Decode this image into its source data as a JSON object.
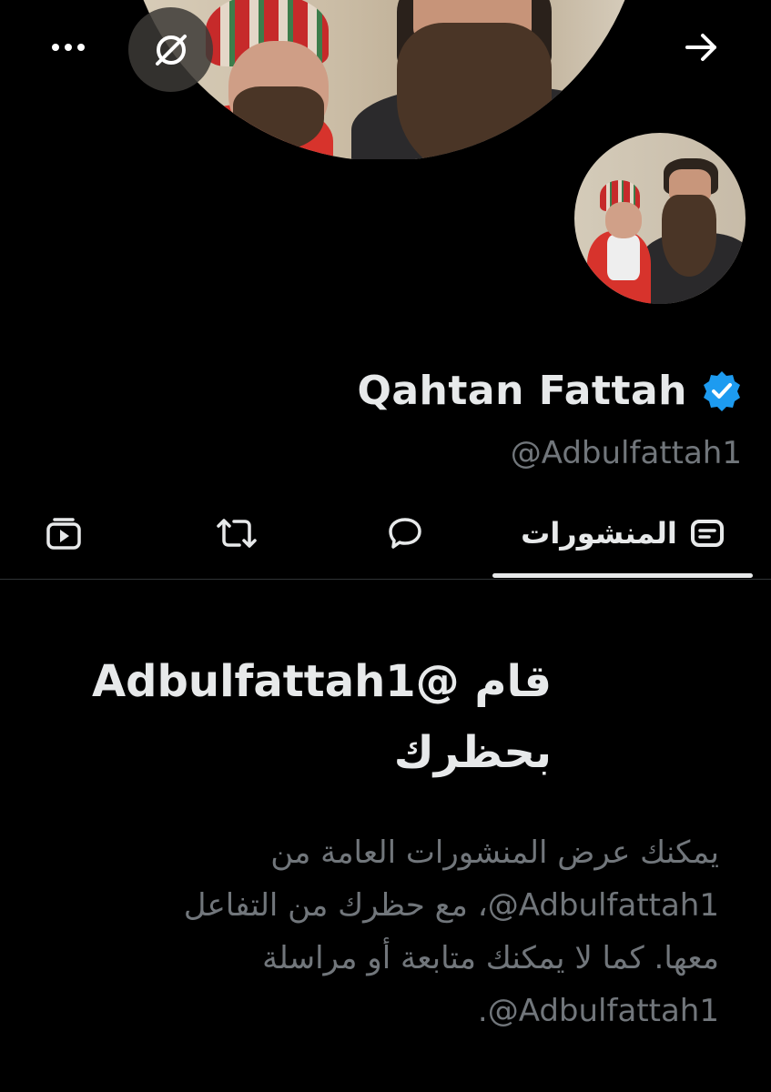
{
  "profile": {
    "display_name": "Qahtan Fattah",
    "handle": "@Adbulfattah1",
    "verified": true,
    "verified_color": "#1d9bf0"
  },
  "header": {
    "more_icon": "more-horizontal-icon",
    "grok_icon": "grok-icon",
    "back_icon": "arrow-right-icon"
  },
  "tabs": [
    {
      "label": "المنشورات",
      "icon": "posts-icon",
      "active": true
    },
    {
      "label": "",
      "icon": "reply-bubble-icon",
      "active": false
    },
    {
      "label": "",
      "icon": "repost-icon",
      "active": false
    },
    {
      "label": "",
      "icon": "media-video-icon",
      "active": false
    }
  ],
  "blocked": {
    "title": "قام @Adbulfattah1 بحظرك",
    "body": "يمكنك عرض المنشورات العامة من ‎@Adbulfattah1‏، مع حظرك من التفاعل معها. كما لا يمكنك متابعة أو مراسلة ‎@Adbulfattah1‏."
  },
  "colors": {
    "background": "#000000",
    "primary_text": "#e7e9ea",
    "secondary_text": "#71767b"
  }
}
